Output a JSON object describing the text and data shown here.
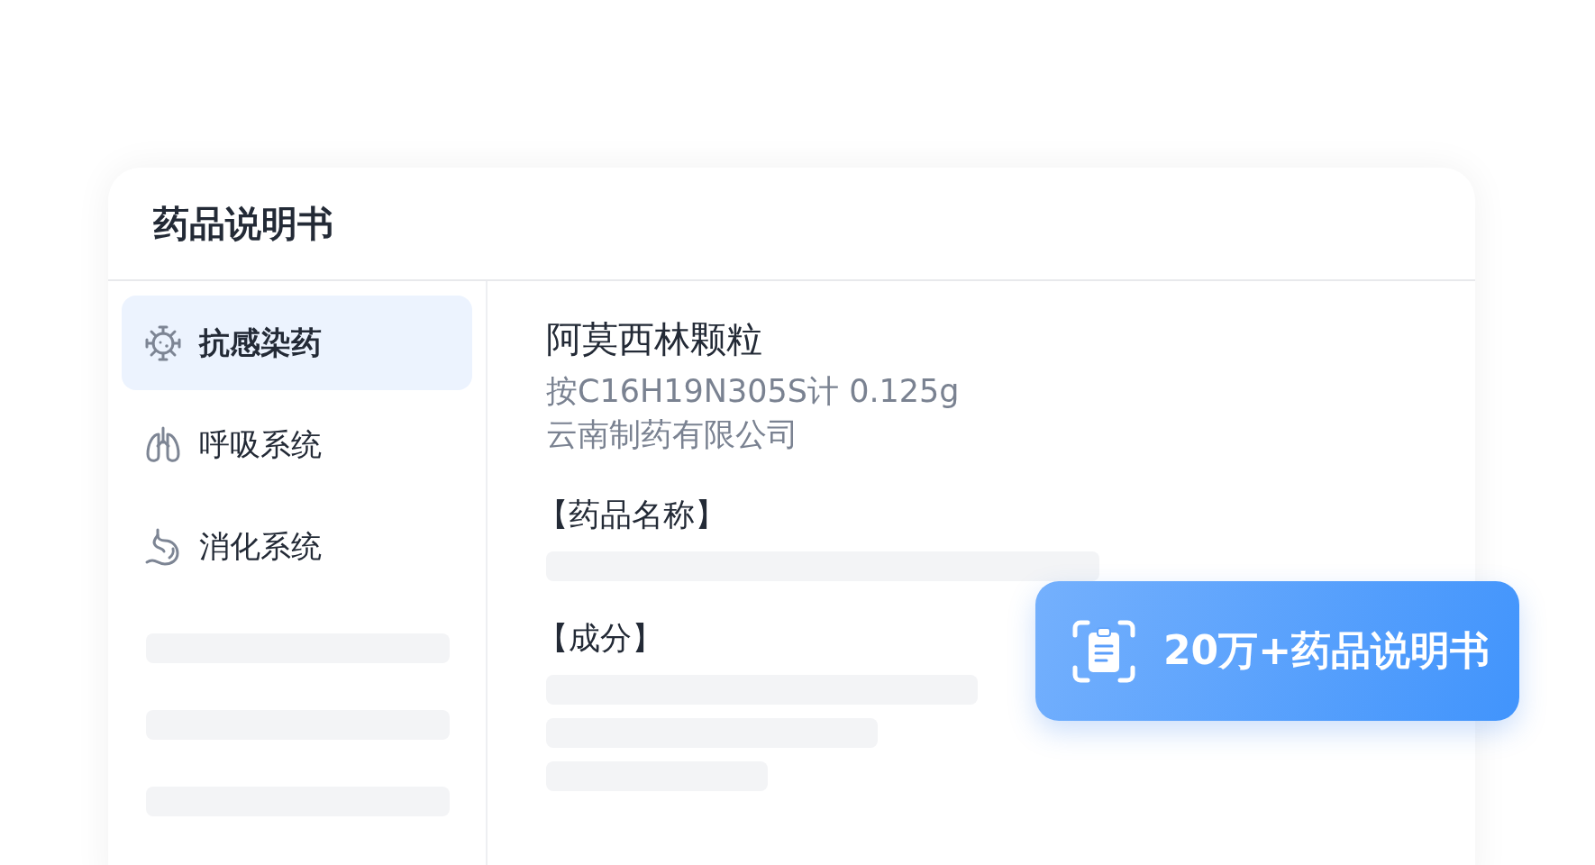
{
  "card": {
    "title": "药品说明书"
  },
  "sidebar": {
    "items": [
      {
        "label": "抗感染药",
        "selected": true
      },
      {
        "label": "呼吸系统",
        "selected": false
      },
      {
        "label": "消化系统",
        "selected": false
      }
    ]
  },
  "drug": {
    "name": "阿莫西林颗粒",
    "spec": "按C16H19N305S计 0.125g",
    "manufacturer": "云南制药有限公司",
    "sections": [
      {
        "heading": "【药品名称】"
      },
      {
        "heading": "【成分】"
      }
    ]
  },
  "badge": {
    "label": "20万+药品说明书"
  }
}
